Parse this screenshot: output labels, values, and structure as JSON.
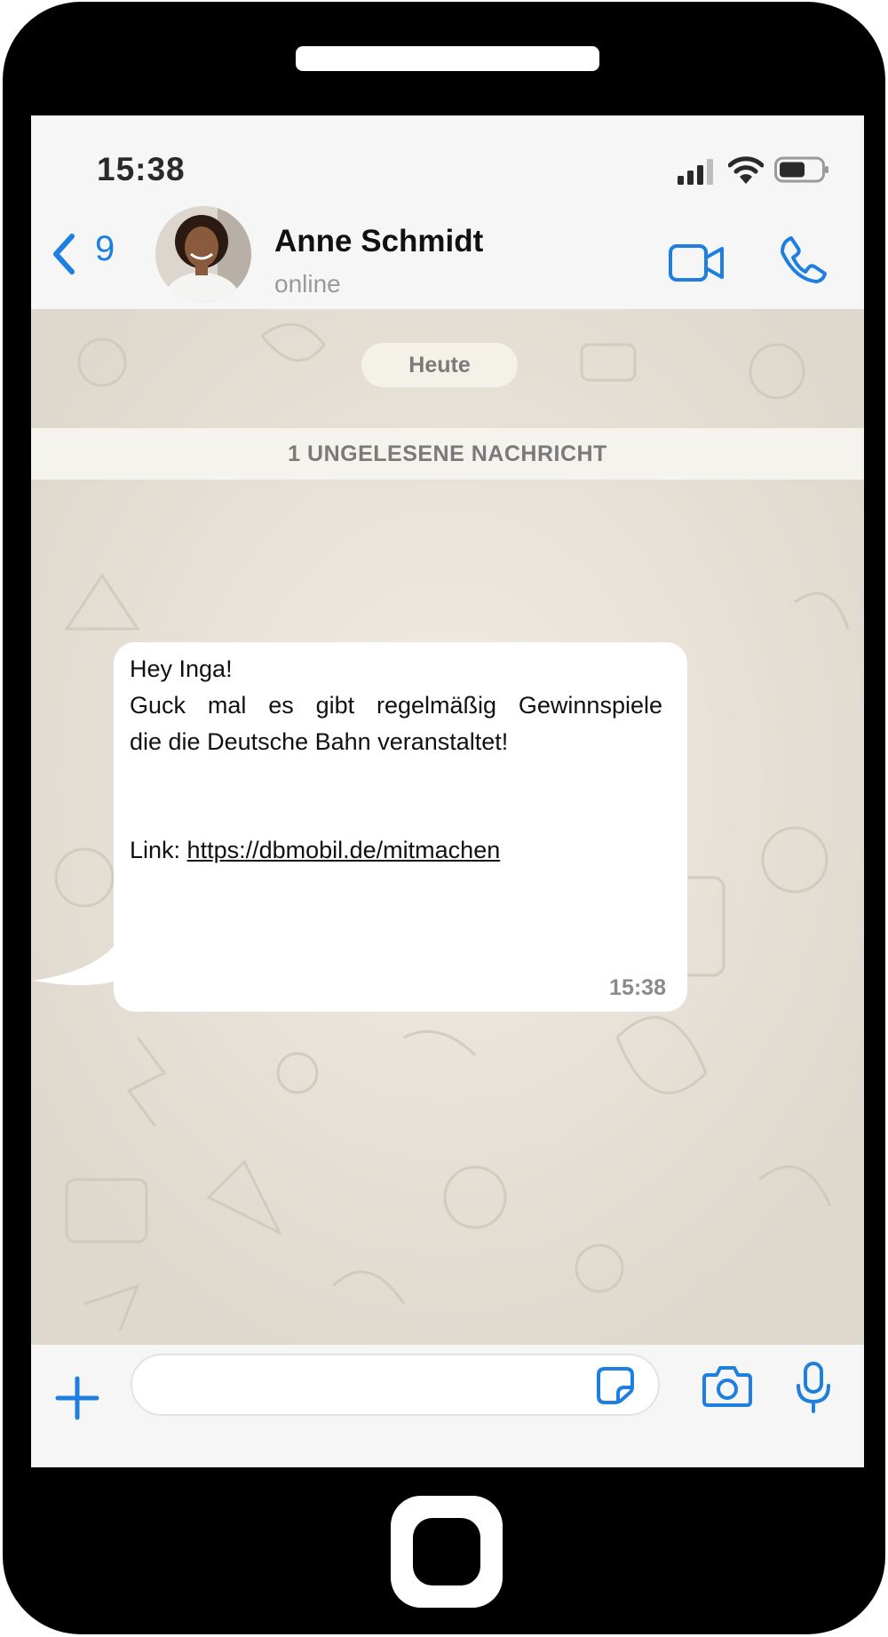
{
  "status_bar": {
    "time": "15:38"
  },
  "header": {
    "back_count": "9",
    "contact_name": "Anne Schmidt",
    "contact_status": "online"
  },
  "chat": {
    "date_label": "Heute",
    "unread_label": "1 UNGELESENE NACHRICHT",
    "message": {
      "greeting": "Hey Inga!",
      "line1": "Guck mal es gibt regelmäßig Gewinnspiele",
      "line2": "die die Deutsche Bahn veranstaltet!",
      "link_prefix": "Link: ",
      "link_text": "https://dbmobil.de/mitmachen",
      "time": "15:38"
    }
  },
  "input": {
    "placeholder": ""
  },
  "colors": {
    "accent": "#1e7fe0",
    "wallpaper": "#e4dfd6",
    "bubble": "#ffffff"
  },
  "icons": [
    "chevron-left-icon",
    "video-call-icon",
    "phone-call-icon",
    "plus-icon",
    "sticker-icon",
    "camera-icon",
    "microphone-icon"
  ]
}
